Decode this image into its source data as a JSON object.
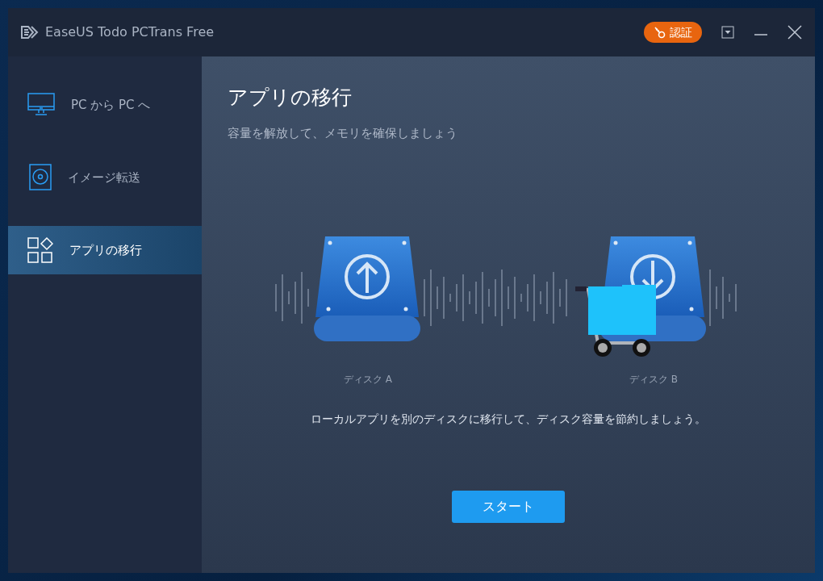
{
  "window": {
    "title": "EaseUS Todo PCTrans Free",
    "activate_button": "認証"
  },
  "sidebar": {
    "items": [
      {
        "kind": "monitor",
        "label": "PC から PC へ",
        "selected": false
      },
      {
        "kind": "disc",
        "label": "イメージ転送",
        "selected": false
      },
      {
        "kind": "apps",
        "label": "アプリの移行",
        "selected": true
      }
    ]
  },
  "main": {
    "title": "アプリの移行",
    "subtitle": "容量を解放して、メモリを確保しましょう",
    "disks": [
      {
        "kind": "source",
        "label": "ディスク A"
      },
      {
        "kind": "target",
        "label": "ディスク B"
      }
    ],
    "description": "ローカルアプリを別のディスクに移行して、ディスク容量を節約しましょう。",
    "start_button": "スタート"
  }
}
